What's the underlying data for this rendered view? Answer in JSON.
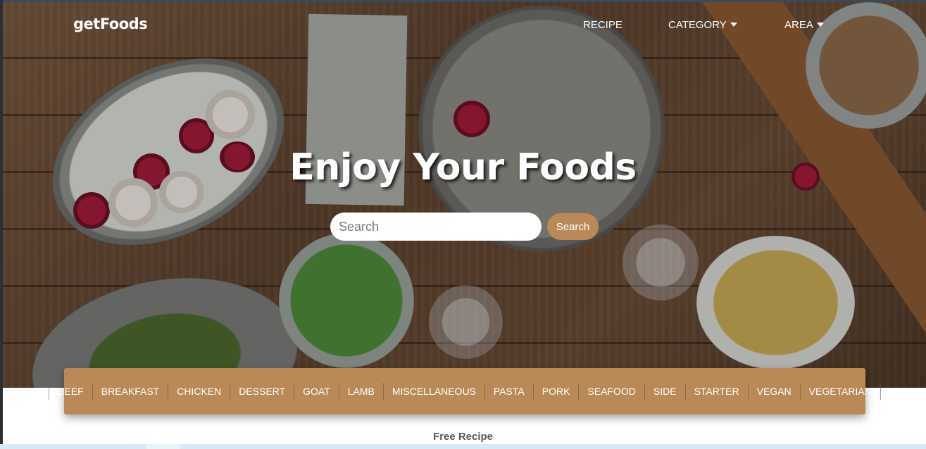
{
  "brand": {
    "name": "getFoods"
  },
  "nav": {
    "items": [
      {
        "label": "RECIPE",
        "dropdown": false
      },
      {
        "label": "CATEGORY",
        "dropdown": true
      },
      {
        "label": "AREA",
        "dropdown": true
      }
    ]
  },
  "hero": {
    "title": "Enjoy Your Foods"
  },
  "search": {
    "placeholder": "Search",
    "value": "",
    "button_label": "Search"
  },
  "categories": [
    "BEEF",
    "BREAKFAST",
    "CHICKEN",
    "DESSERT",
    "GOAT",
    "LAMB",
    "MISCELLANEOUS",
    "PASTA",
    "PORK",
    "SEAFOOD",
    "SIDE",
    "STARTER",
    "VEGAN",
    "VEGETARIAN"
  ],
  "section": {
    "title": "Free Recipe"
  },
  "colors": {
    "accent": "#b98a57",
    "text_white": "#ffffff",
    "muted_text": "#555a60"
  },
  "icons": {
    "dropdown": "caret-down-icon"
  }
}
